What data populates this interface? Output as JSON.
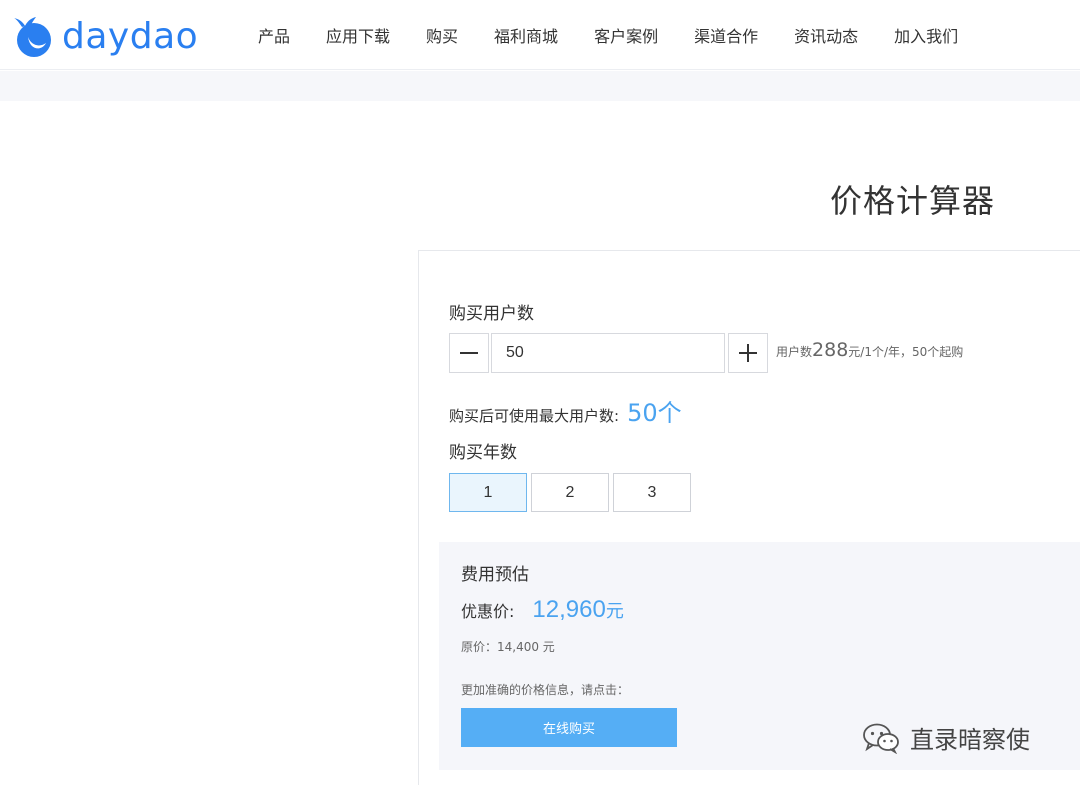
{
  "header": {
    "logo_text": "daydao",
    "nav": [
      "产品",
      "应用下载",
      "购买",
      "福利商城",
      "客户案例",
      "渠道合作",
      "资讯动态",
      "加入我们"
    ]
  },
  "calculator": {
    "title": "价格计算器",
    "users_label": "购买用户数",
    "quantity_value": "50",
    "price_note_prefix": "用户数",
    "price_note_amount": "288",
    "price_note_suffix": "元/1个/年，50个起购",
    "max_users_label": "购买后可使用最大用户数:",
    "max_users_value": "50个",
    "years_label": "购买年数",
    "year_options": [
      "1",
      "2",
      "3"
    ],
    "selected_year": "1"
  },
  "estimate": {
    "title": "费用预估",
    "discount_label": "优惠价:",
    "discount_value": "12,960",
    "discount_unit": "元",
    "original_price": "原价：14,400 元",
    "hint": "更加准确的价格信息，请点击：",
    "buy_label": "在线购买"
  },
  "watermark": {
    "text": "直录暗察使",
    "icon": "wechat-icon"
  },
  "colors": {
    "brand": "#2a7ff0",
    "accent": "#4aa3f0",
    "button": "#55aef5",
    "selected_bg": "#eaf5fd",
    "estimate_bg": "#f5f6fa"
  }
}
